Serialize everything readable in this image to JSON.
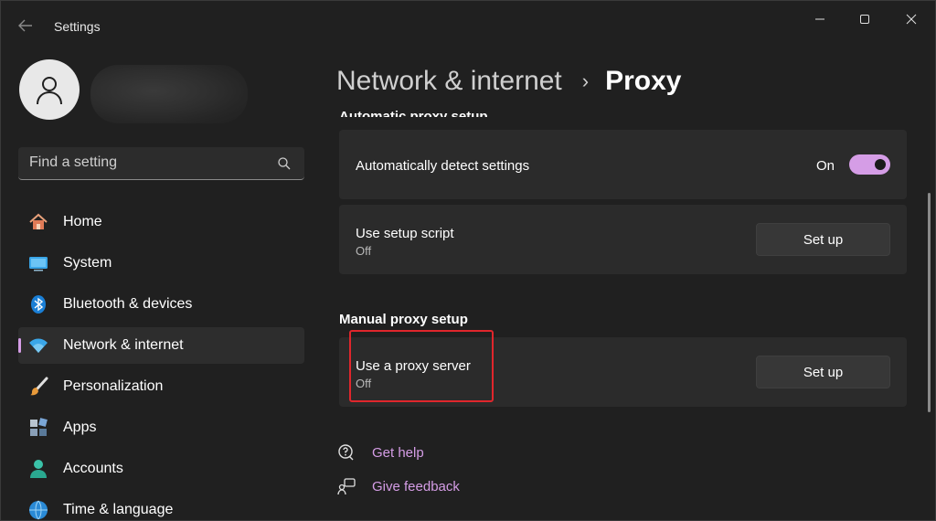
{
  "window": {
    "title": "Settings"
  },
  "sidebar": {
    "search": {
      "placeholder": "Find a setting"
    },
    "items": [
      {
        "label": "Home",
        "icon": "home-icon"
      },
      {
        "label": "System",
        "icon": "system-icon"
      },
      {
        "label": "Bluetooth & devices",
        "icon": "bluetooth-icon"
      },
      {
        "label": "Network & internet",
        "icon": "wifi-icon",
        "active": true
      },
      {
        "label": "Personalization",
        "icon": "brush-icon"
      },
      {
        "label": "Apps",
        "icon": "apps-icon"
      },
      {
        "label": "Accounts",
        "icon": "accounts-icon"
      },
      {
        "label": "Time & language",
        "icon": "globe-icon"
      }
    ]
  },
  "header": {
    "parent": "Network & internet",
    "separator": "›",
    "current": "Proxy"
  },
  "auto_proxy": {
    "heading": "Automatic proxy setup",
    "detect": {
      "title": "Automatically detect settings",
      "state": "On"
    },
    "script": {
      "title": "Use setup script",
      "subtitle": "Off",
      "button": "Set up"
    }
  },
  "manual_proxy": {
    "heading": "Manual proxy setup",
    "server": {
      "title": "Use a proxy server",
      "subtitle": "Off",
      "button": "Set up"
    }
  },
  "links": {
    "help": "Get help",
    "feedback": "Give feedback"
  },
  "colors": {
    "accent": "#d59de6",
    "background": "#202020",
    "card": "#2b2b2b",
    "highlight": "#e0262c"
  }
}
